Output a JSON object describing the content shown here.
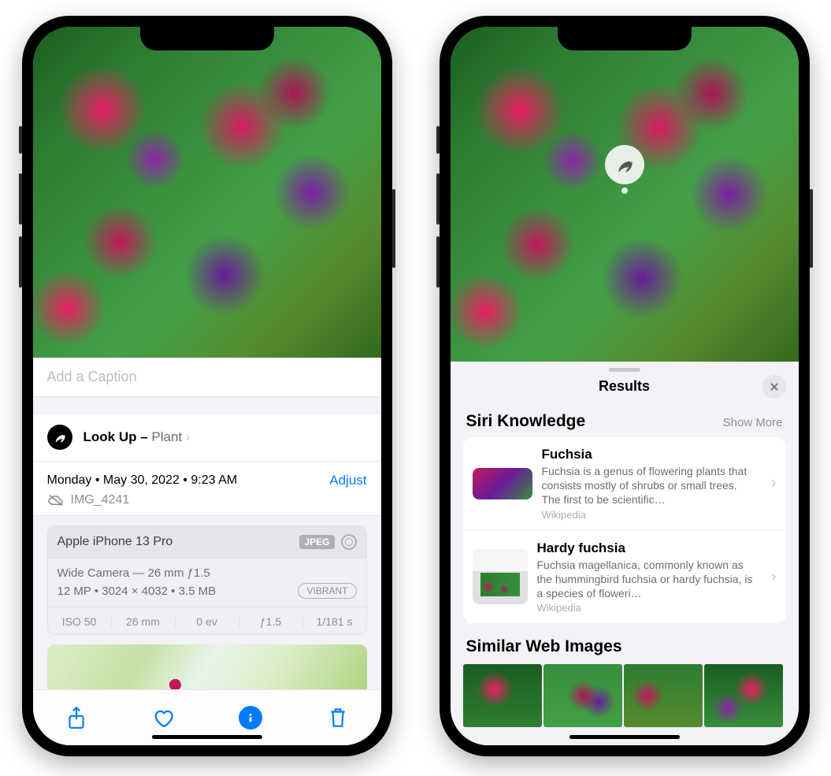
{
  "left": {
    "caption_placeholder": "Add a Caption",
    "lookup": {
      "label": "Look Up – ",
      "subject": "Plant"
    },
    "date_line": "Monday • May 30, 2022 • 9:23 AM",
    "adjust_label": "Adjust",
    "filename": "IMG_4241",
    "camera": {
      "device": "Apple iPhone 13 Pro",
      "format_badge": "JPEG",
      "lens_line": "Wide Camera — 26 mm ƒ1.5",
      "sensor_line": "12 MP  •  3024 × 4032  •  3.5 MB",
      "effect_badge": "VIBRANT",
      "specs": {
        "iso": "ISO 50",
        "focal": "26 mm",
        "ev": "0 ev",
        "aperture": "ƒ1.5",
        "shutter": "1/181 s"
      }
    }
  },
  "right": {
    "panel_title": "Results",
    "section_siri": "Siri Knowledge",
    "show_more": "Show More",
    "results": [
      {
        "title": "Fuchsia",
        "desc": "Fuchsia is a genus of flowering plants that consists mostly of shrubs or small trees. The first to be scientific…",
        "source": "Wikipedia"
      },
      {
        "title": "Hardy fuchsia",
        "desc": "Fuchsia magellanica, commonly known as the hummingbird fuchsia or hardy fuchsia, is a species of floweri…",
        "source": "Wikipedia"
      }
    ],
    "section_web": "Similar Web Images"
  },
  "colors": {
    "accent": "#007aff"
  }
}
